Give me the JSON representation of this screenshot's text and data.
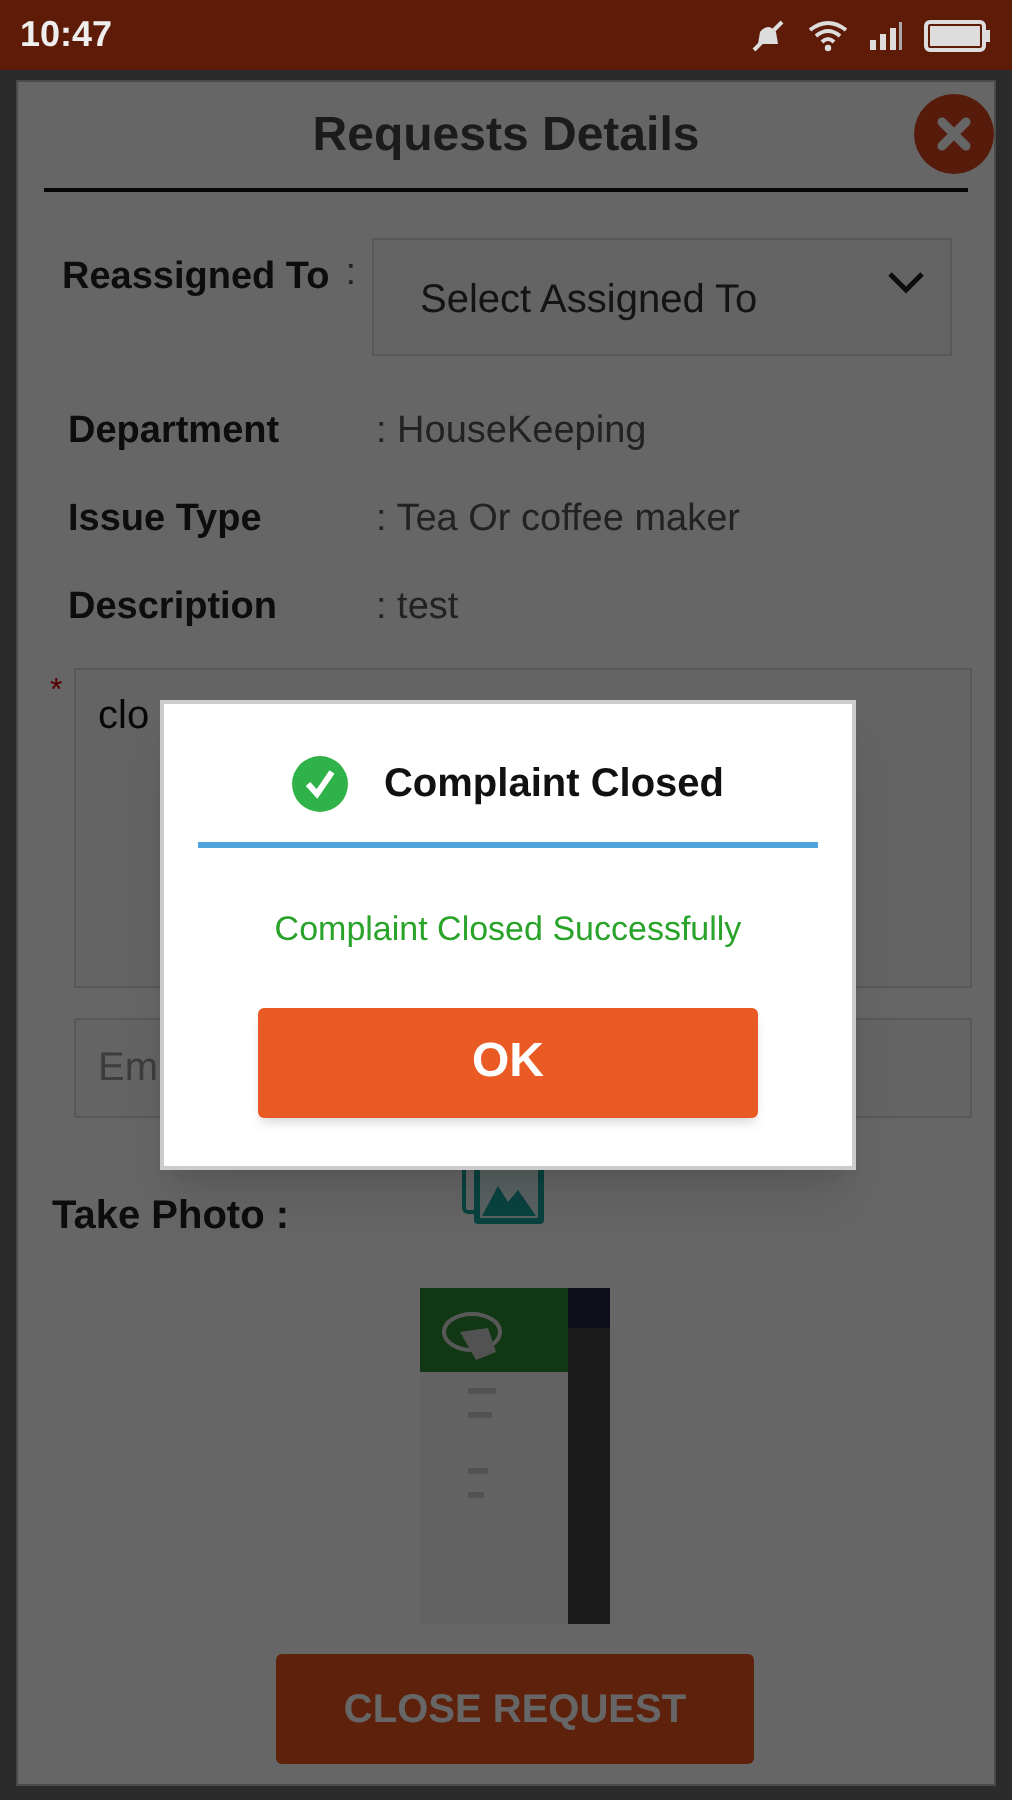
{
  "status_bar": {
    "time": "10:47"
  },
  "screen": {
    "title": "Requests Details",
    "reassign": {
      "label": "Reassigned To",
      "colon": ":",
      "placeholder": "Select Assigned To"
    },
    "details": [
      {
        "label": "Department",
        "value": ": HouseKeeping"
      },
      {
        "label": "Issue Type",
        "value": ": Tea Or coffee maker"
      },
      {
        "label": "Description",
        "value": ": test"
      }
    ],
    "remarks": {
      "required_mark": "*",
      "value": "clo"
    },
    "email": {
      "value": "Em"
    },
    "photo": {
      "label": "Take Photo :",
      "kind": "picture"
    },
    "close_button": "CLOSE REQUEST"
  },
  "dialog": {
    "title": "Complaint Closed",
    "message": "Complaint Closed Successfully",
    "button": "OK"
  }
}
